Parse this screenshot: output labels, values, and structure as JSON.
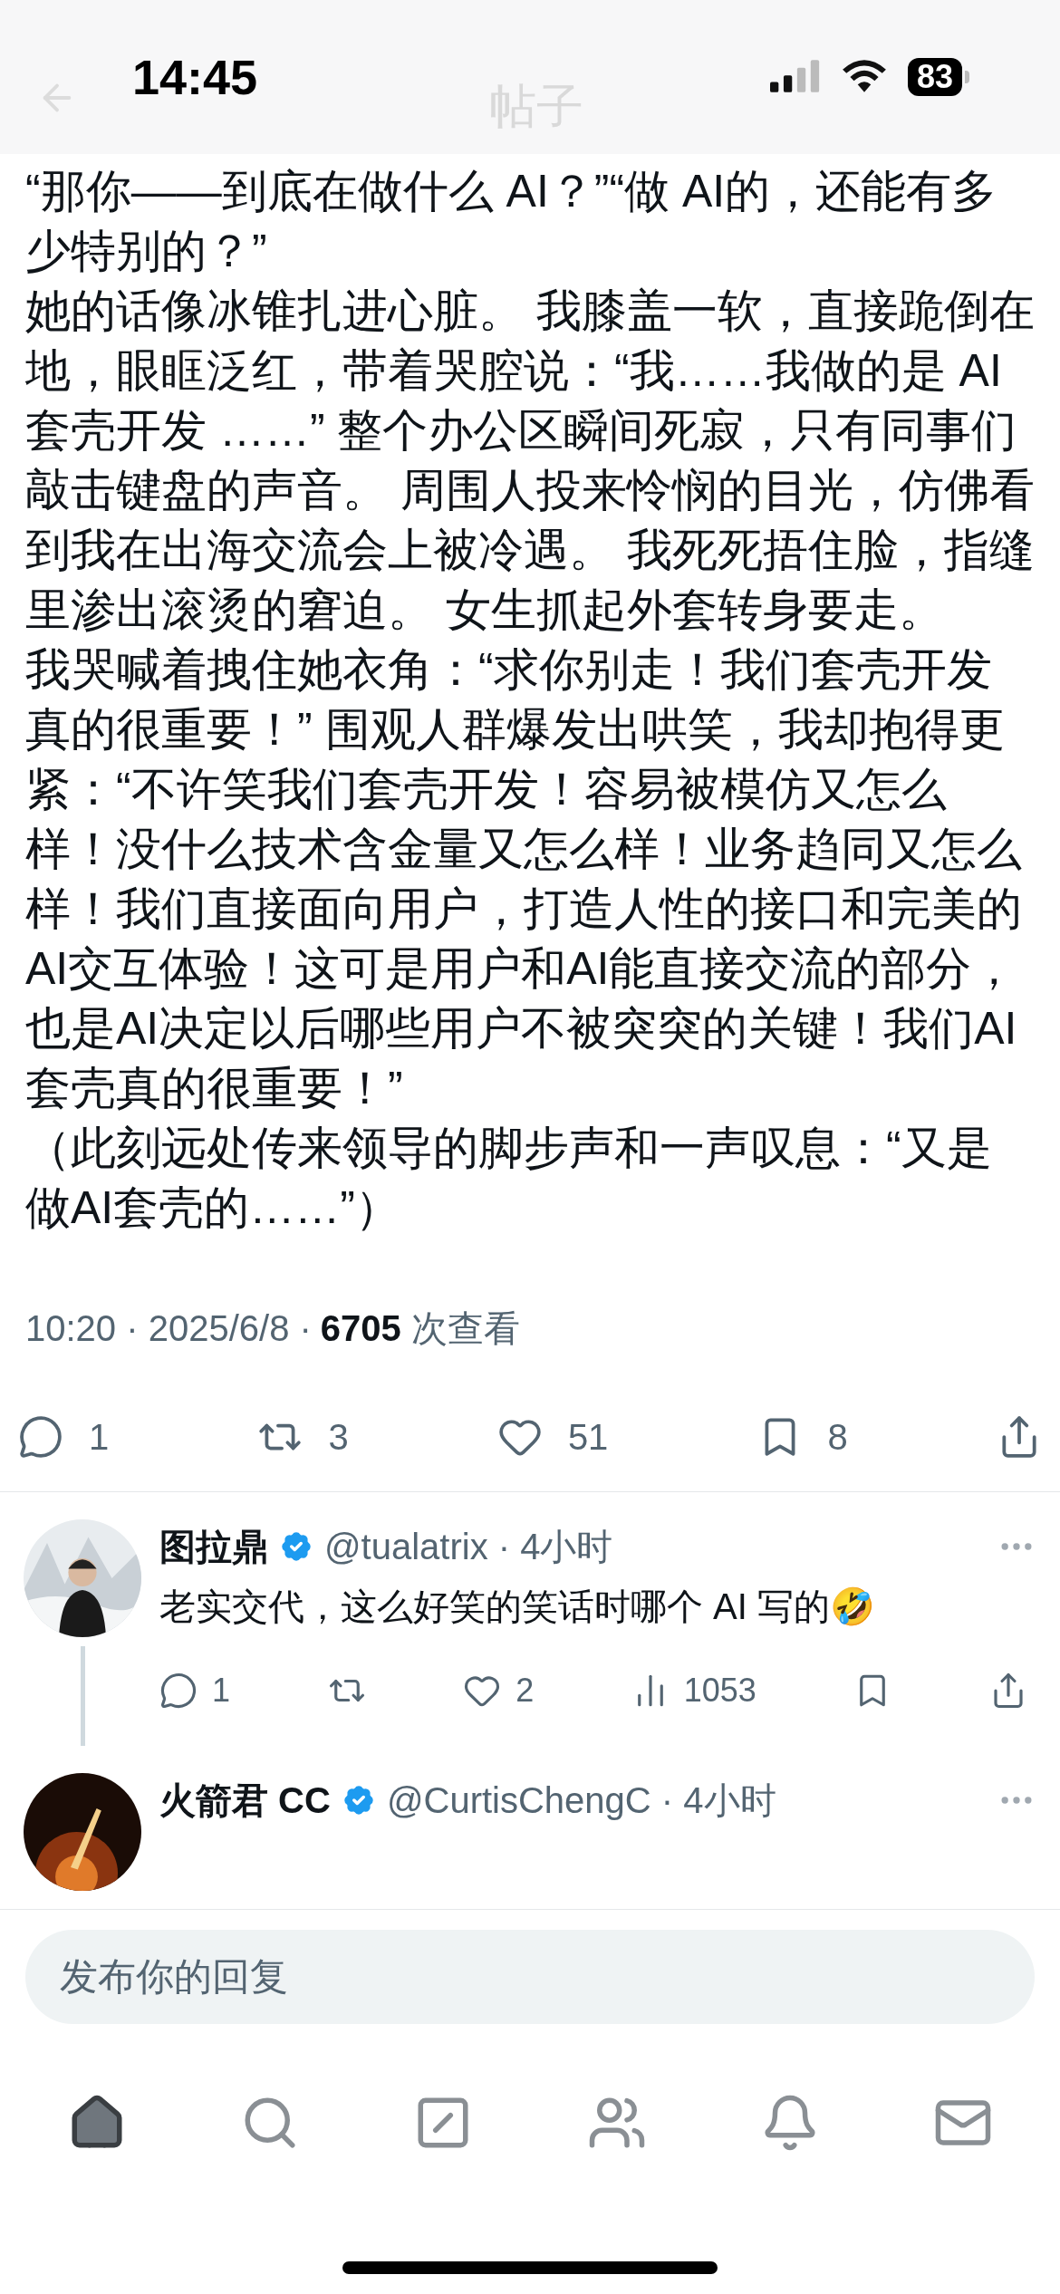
{
  "status_bar": {
    "time": "14:45",
    "battery": "83"
  },
  "header": {
    "title": "帖子"
  },
  "post": {
    "paragraphs": [
      "“那你——到底在做什么 AI？”“做 AI的，还能有多少特别的？”",
      "她的话像冰锥扎进心脏。 我膝盖一软，直接跪倒在地，眼眶泛红，带着哭腔说：“我……我做的是 AI 套壳开发 ……” 整个办公区瞬间死寂，只有同事们敲击键盘的声音。 周围人投来怜悯的目光，仿佛看到我在出海交流会上被冷遇。 我死死捂住脸，指缝里渗出滚烫的窘迫。 女生抓起外套转身要走。",
      "我哭喊着拽住她衣角：“求你别走！我们套壳开发真的很重要！” 围观人群爆发出哄笑，我却抱得更紧：“不许笑我们套壳开发！容易被模仿又怎么样！没什么技术含金量又怎么样！业务趋同又怎么样！我们直接面向用户，打造人性的接口和完美的AI交互体验！这可是用户和AI能直接交流的部分，也是AI决定以后哪些用户不被突突的关键！我们AI套壳真的很重要！”",
      "（此刻远处传来领导的脚步声和一声叹息：“又是做AI套壳的……”）"
    ],
    "meta": {
      "time": "10:20",
      "date": "2025/6/8",
      "views": "6705",
      "views_label": "次查看"
    },
    "actions": [
      {
        "kind": "reply",
        "count": "1"
      },
      {
        "kind": "repost",
        "count": "3"
      },
      {
        "kind": "like",
        "count": "51"
      },
      {
        "kind": "bookmark",
        "count": "8"
      },
      {
        "kind": "share"
      }
    ]
  },
  "separator": "·",
  "replies": [
    {
      "name": "图拉鼎",
      "verified": true,
      "handle": "@tualatrix",
      "time": "4小时",
      "text": "老实交代，这么好笑的笑话时哪个 AI 写的🤣",
      "actions": [
        {
          "kind": "reply",
          "count": "1"
        },
        {
          "kind": "repost"
        },
        {
          "kind": "like",
          "count": "2"
        },
        {
          "kind": "views",
          "count": "1053"
        },
        {
          "kind": "bookmark"
        },
        {
          "kind": "share"
        }
      ]
    },
    {
      "name": "火箭君 CC",
      "verified": true,
      "handle": "@CurtisChengC",
      "time": "4小时"
    }
  ],
  "reply_box": {
    "placeholder": "发布你的回复"
  },
  "tab_bar": [
    {
      "kind": "home",
      "selected": true
    },
    {
      "kind": "search",
      "selected": false
    },
    {
      "kind": "compose",
      "selected": false
    },
    {
      "kind": "communities",
      "selected": false
    },
    {
      "kind": "notifications",
      "selected": false
    },
    {
      "kind": "messages",
      "selected": false
    }
  ]
}
